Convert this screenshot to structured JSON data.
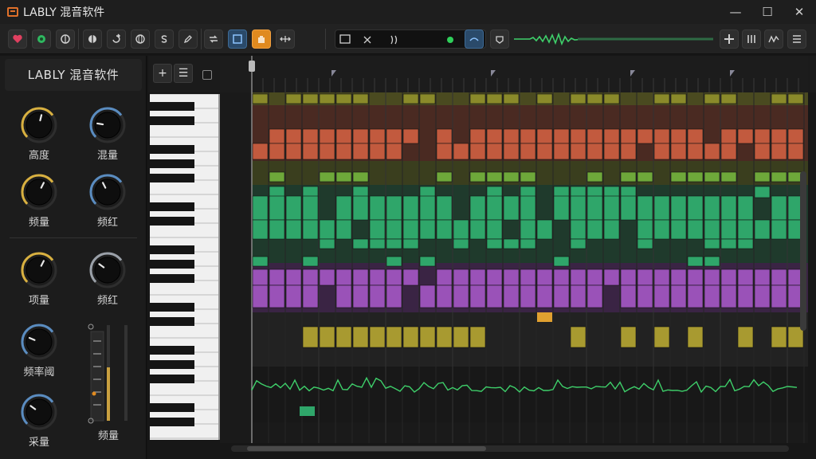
{
  "window": {
    "title": "LABLY 混音软件",
    "minimize": "—",
    "maximize": "☐",
    "close": "✕"
  },
  "toolbar": {
    "left_icons": [
      "heart-icon",
      "record-icon",
      "compass-icon",
      "split-icon",
      "redo-icon",
      "globe-icon",
      "dollar-icon",
      "pen-icon"
    ],
    "mid_icons": [
      "loop-icon",
      "select-tool-icon",
      "hand-tool-icon",
      "move-icon"
    ],
    "transport_icons": [
      "track-icon",
      "speaker-icon",
      "audio-wave-icon",
      "play-indicator-icon",
      "metronome-icon"
    ],
    "right_icons": [
      "plugin-icon",
      "bars-icon",
      "automation-icon",
      "menu-icon"
    ],
    "accent_active": "#3d6a95",
    "accent_orange": "#e08a1f"
  },
  "left_panel": {
    "brand": "LABLY 混音软件",
    "knobs": [
      {
        "label": "高度",
        "value": 0.55,
        "ring": "#d8b040"
      },
      {
        "label": "混量",
        "value": 0.2,
        "ring": "#5a8cc0"
      },
      {
        "label": "频量",
        "value": 0.6,
        "ring": "#d8b040"
      },
      {
        "label": "频红",
        "value": 0.4,
        "ring": "#5a8cc0"
      },
      {
        "label": "项量",
        "value": 0.6,
        "ring": "#d8b040"
      },
      {
        "label": "频红",
        "value": 0.3,
        "ring": "#9aa0a8"
      },
      {
        "label": "频率阈",
        "value": 0.25,
        "ring": "#5a8cc0"
      },
      {
        "label": "采量",
        "value": 0.3,
        "ring": "#5a8cc0"
      }
    ],
    "fader_label": "频量"
  },
  "piano_roll": {
    "add_label": "+",
    "list_label": "☰",
    "lanes": [
      {
        "name": "olive",
        "color": "#8a8a2a",
        "bg": "#4a4a20"
      },
      {
        "name": "red",
        "color": "#c25a3e",
        "bg": "#4a2a22"
      },
      {
        "name": "green",
        "color": "#6ea83a",
        "bg": "#3a3e1e"
      },
      {
        "name": "teal",
        "color": "#2fa66a",
        "bg": "#1f3a2c"
      },
      {
        "name": "purple",
        "color": "#9a52b8",
        "bg": "#3a2444"
      },
      {
        "name": "yellow",
        "color": "#a89a30",
        "bg": "#222"
      },
      {
        "name": "wave",
        "color": "#3ecf6a",
        "bg": "#181818"
      }
    ]
  }
}
